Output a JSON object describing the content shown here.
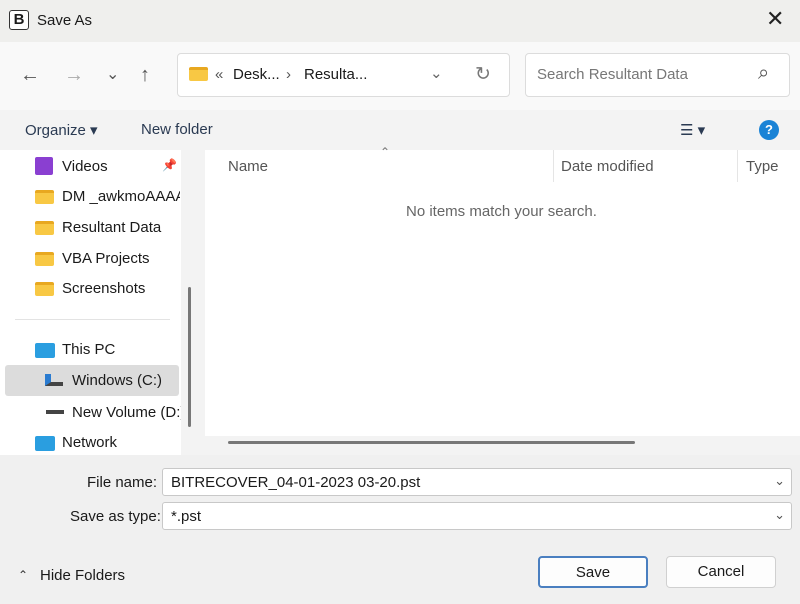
{
  "window": {
    "title": "Save As",
    "app_icon": "B",
    "close": "✕"
  },
  "nav": {
    "back": "←",
    "forward": "→",
    "recent": "⌄",
    "up": "↑",
    "refresh": "↻"
  },
  "address": {
    "prefix": "«",
    "crumbs": [
      "Desk...",
      "Resulta..."
    ],
    "sep": "›",
    "dropdown": "⌄"
  },
  "search": {
    "placeholder": "Search Resultant Data",
    "icon": "⌕"
  },
  "toolbar": {
    "organize": "Organize ▾",
    "new_folder": "New folder",
    "view": "☰ ▾",
    "help": "?"
  },
  "sidebar": {
    "items": [
      {
        "label": "Videos",
        "icon": "videos"
      },
      {
        "label": "DM _awkmoAAAA",
        "icon": "folder"
      },
      {
        "label": "Resultant Data",
        "icon": "folder"
      },
      {
        "label": "VBA Projects",
        "icon": "folder"
      },
      {
        "label": "Screenshots",
        "icon": "folder"
      },
      {
        "label": "This PC",
        "icon": "pc"
      },
      {
        "label": "Windows (C:)",
        "icon": "drive"
      },
      {
        "label": "New Volume (D:)",
        "icon": "drive"
      },
      {
        "label": "Network",
        "icon": "network"
      }
    ]
  },
  "columns": [
    "Name",
    "Date modified",
    "Type"
  ],
  "empty_message": "No items match your search.",
  "form": {
    "file_name_label": "File name:",
    "file_name": "BITRECOVER_04-01-2023 03-20.pst",
    "type_label": "Save as type:",
    "type": "*.pst"
  },
  "footer": {
    "hide_folders": "Hide Folders",
    "save": "Save",
    "cancel": "Cancel"
  }
}
